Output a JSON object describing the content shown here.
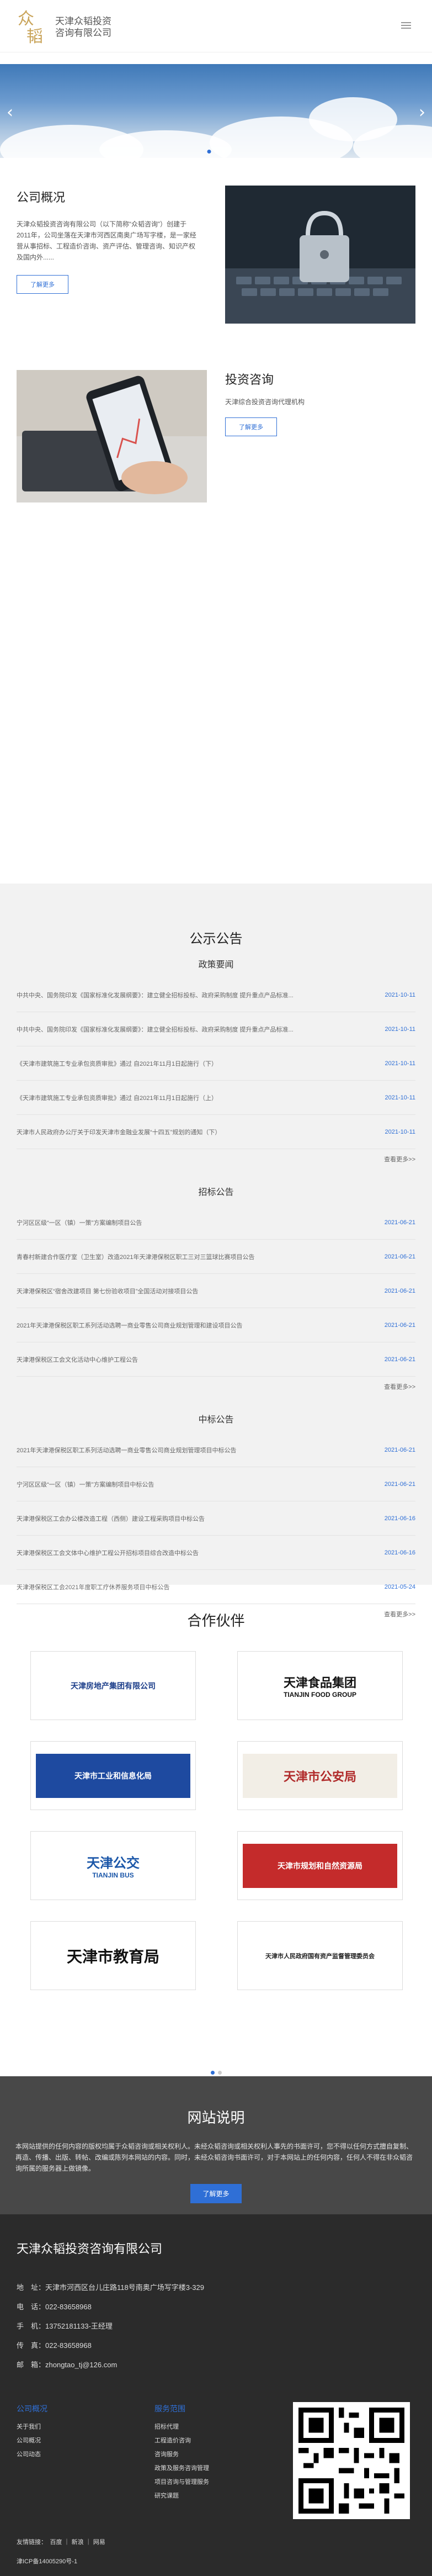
{
  "header": {
    "logo_text": "天津众韬投资咨询有限公司",
    "logo_line1": "天津众韬投资",
    "logo_line2": "咨询有限公司"
  },
  "banner": {
    "prev_icon": "chevron-left-icon",
    "next_icon": "chevron-right-icon",
    "slides": 3,
    "active_slide": 1
  },
  "about": {
    "title": "公司概况",
    "text": "天津众韬投资咨询有限公司（以下简称“众韬咨询”）创建于2011年，公司坐落在天津市河西区南奥广场写字楼，是一家经营从事招标、工程造价咨询、资产评估、管理咨询、知识产权及国内外......",
    "button": "了解更多"
  },
  "invest": {
    "title": "投资咨询",
    "text": "天津综合投资咨询代理机构",
    "button": "了解更多"
  },
  "notice": {
    "title": "公示公告",
    "groups": [
      {
        "name": "政策要闻",
        "rows": [
          {
            "t": "中共中央、国务院印发《国家标准化发展纲要》：建立健全招标投标、政府采购制度 提升重点产品标准...",
            "d": "2021-10-11"
          },
          {
            "t": "中共中央、国务院印发《国家标准化发展纲要》：建立健全招标投标、政府采购制度 提升重点产品标准...",
            "d": "2021-10-11"
          },
          {
            "t": "《天津市建筑施工专业承包资质审批》通过 自2021年11月1日起施行（下）",
            "d": "2021-10-11"
          },
          {
            "t": "《天津市建筑施工专业承包资质审批》通过 自2021年11月1日起施行（上）",
            "d": "2021-10-11"
          },
          {
            "t": "天津市人民政府办公厅关于印发天津市金融业发展“十四五”规划的通知（下）",
            "d": "2021-10-11"
          }
        ]
      },
      {
        "name": "招标公告",
        "rows": [
          {
            "t": "宁河区区级“一区（镇）一策”方案编制项目公告",
            "d": "2021-06-21"
          },
          {
            "t": "青春村新建合作医疗室（卫生室）改造2021年天津港保税区职工三对三篮球比赛项目公告",
            "d": "2021-06-21"
          },
          {
            "t": "天津港保税区“宿舍改建项目 第七份验收项目”全国活动对接项目公告",
            "d": "2021-06-21"
          },
          {
            "t": "2021年天津港保税区职工系列活动选聘一商业零售公司商业规划管理和建设项目公告",
            "d": "2021-06-21"
          },
          {
            "t": "天津港保税区工会文化活动中心维护工程公告",
            "d": "2021-06-21"
          }
        ]
      },
      {
        "name": "中标公告",
        "rows": [
          {
            "t": "2021年天津港保税区职工系列活动选聘一商业零售公司商业规划管理项目中标公告",
            "d": "2021-06-21"
          },
          {
            "t": "宁河区区级“一区（镇）一策”方案编制项目中标公告",
            "d": "2021-06-21"
          },
          {
            "t": "天津港保税区工会办公楼改造工程（西侧）建设工程采购项目中标公告",
            "d": "2021-06-16"
          },
          {
            "t": "天津港保税区工会文体中心维护工程公开招标项目综合改造中标公告",
            "d": "2021-06-16"
          },
          {
            "t": "天津港保税区工会2021年度职工疗休养服务项目中标公告",
            "d": "2021-05-24"
          }
        ]
      }
    ],
    "more": "查看更多>>"
  },
  "partners": {
    "title": "合作伙伴",
    "items": [
      {
        "name": "天津房地产集团有限公司",
        "logo": "tianjin-real-estate-logo"
      },
      {
        "name": "天津食品集团",
        "sub": "TIANJIN FOOD GROUP",
        "logo": "tianjin-food-logo"
      },
      {
        "name": "天津市工业和信息化局",
        "logo": "tianjin-industry-logo"
      },
      {
        "name": "天津市公安局",
        "logo": "tianjin-police-logo"
      },
      {
        "name": "天津公交",
        "sub": "TIANJIN BUS",
        "logo": "tianjin-bus-logo"
      },
      {
        "name": "天津市规划和自然资源局",
        "logo": "tianjin-planning-logo"
      },
      {
        "name": "天津市教育局",
        "logo": "tianjin-education-logo"
      },
      {
        "name": "天津市人民政府国有资产监督管理委员会",
        "logo": "tianjin-sasac-logo"
      }
    ]
  },
  "statement": {
    "title": "网站说明",
    "body": "本网站提供的任何内容的版权均属于众韬咨询或相关权利人。未经众韬咨询或相关权利人事先的书面许可，您不得以任何方式擅自复制、再造、传播、出版、转帖、改编或陈列本网站的内容。同时，未经众韬咨询书面许可，对于本网站上的任何内容，任何人不得在非众韬咨询所属的服务器上做镜像。",
    "button": "了解更多"
  },
  "footer": {
    "company": "天津众韬投资咨询有限公司",
    "contacts": [
      {
        "label": "地　址：",
        "value": "天津市河西区台儿庄路118号南奥广场写字楼3-329"
      },
      {
        "label": "电　话：",
        "value": "022-83658968"
      },
      {
        "label": "手　机：",
        "value": "13752181133-王经理"
      },
      {
        "label": "传　真：",
        "value": "022-83658968"
      },
      {
        "label": "邮　箱：",
        "value": "zhongtao_tj@126.com"
      }
    ],
    "col1_head": "公司概况",
    "col1": [
      "关于我们",
      "公司概况",
      "公司动态"
    ],
    "col2_head": "服务范围",
    "col2": [
      "招标代理",
      "工程造价咨询",
      "咨询服务",
      "政策及服务咨询管理",
      "项目咨询与管理服务",
      "研究课题"
    ],
    "links": "友情链接：　百度 ｜ 新浪 ｜ 网易",
    "icp": "津ICP备14005290号-1"
  }
}
